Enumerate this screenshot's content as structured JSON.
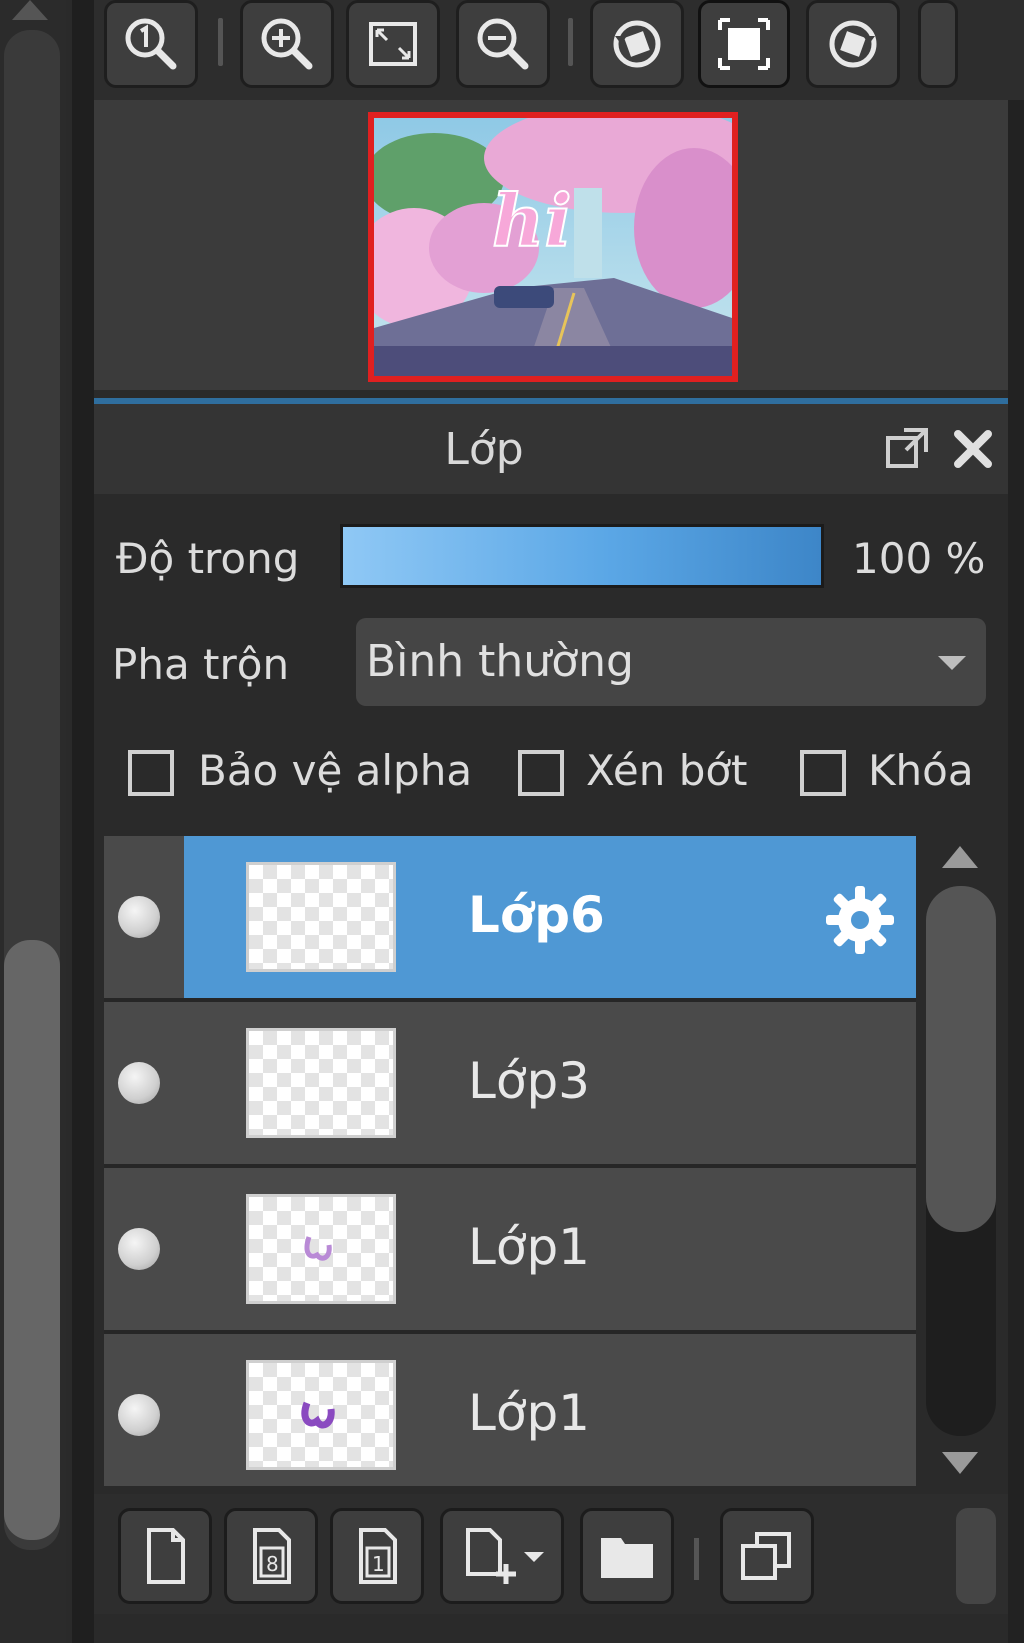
{
  "toolbar": {
    "buttons": [
      {
        "icon": "zoom-actual-size-icon"
      },
      {
        "icon": "zoom-in-icon"
      },
      {
        "icon": "fit-screen-icon"
      },
      {
        "icon": "zoom-out-icon"
      },
      {
        "icon": "rotate-left-icon"
      },
      {
        "icon": "fullscreen-icon"
      },
      {
        "icon": "rotate-right-icon"
      }
    ]
  },
  "navigator": {
    "preview_text": "hi"
  },
  "layer_panel": {
    "title": "Lớp",
    "opacity_label": "Độ trong",
    "opacity_value": "100 %",
    "opacity_fraction": 1.0,
    "blend_label": "Pha trộn",
    "blend_mode": "Bình thường",
    "checkboxes": {
      "protect_alpha": {
        "label": "Bảo vệ alpha",
        "checked": false
      },
      "clipping": {
        "label": "Xén bớt",
        "checked": false
      },
      "lock": {
        "label": "Khóa",
        "checked": false
      }
    },
    "layers": [
      {
        "name": "Lớp6",
        "selected": true
      },
      {
        "name": "Lớp3",
        "selected": false
      },
      {
        "name": "Lớp1",
        "selected": false
      },
      {
        "name": "Lớp1",
        "selected": false
      }
    ]
  },
  "bottom_toolbar": {
    "buttons": [
      {
        "icon": "new-layer-icon"
      },
      {
        "icon": "new-8bit-layer-icon"
      },
      {
        "icon": "new-1bit-layer-icon"
      },
      {
        "icon": "add-layer-menu-icon"
      },
      {
        "icon": "folder-icon"
      },
      {
        "icon": "duplicate-layer-icon"
      }
    ]
  },
  "colors": {
    "selection": "#4f98d4",
    "navigator_frame": "#e02020",
    "opacity_bar": "#5ba7e6",
    "panel_background": "#2a2a2a"
  }
}
